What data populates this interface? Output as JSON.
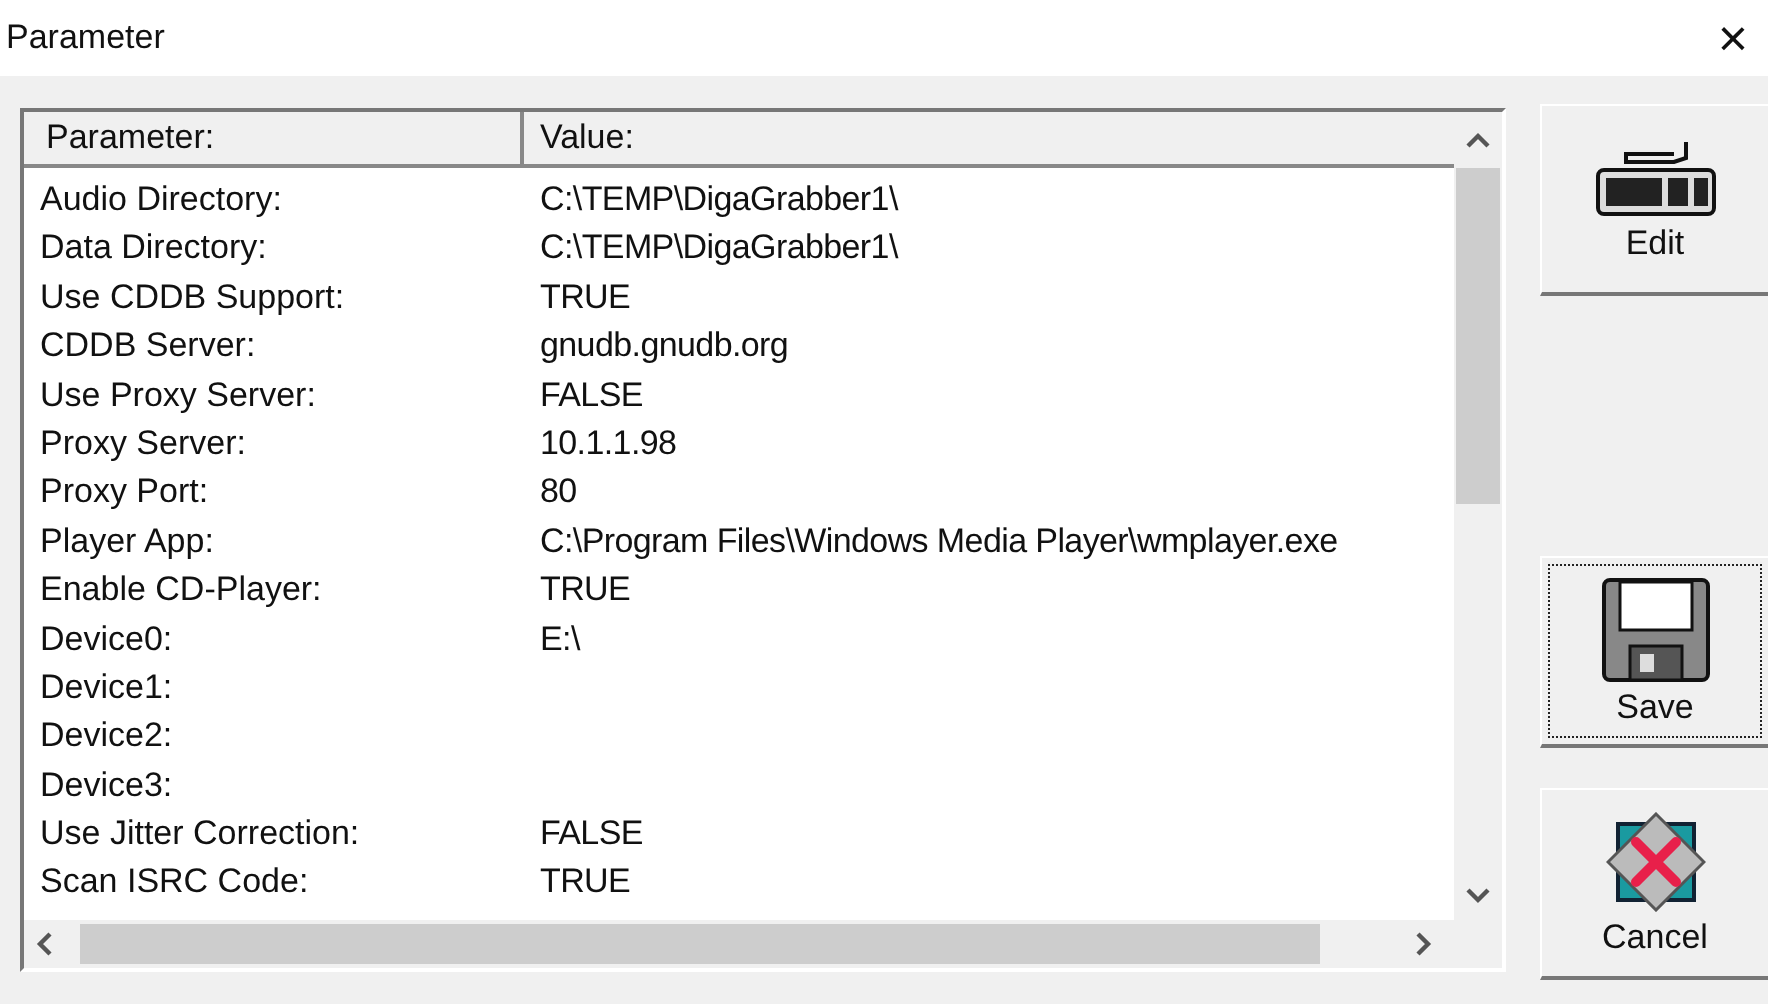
{
  "window": {
    "title": "Parameter",
    "close": "×"
  },
  "table": {
    "columns": [
      "Parameter:",
      "Value:"
    ],
    "rows": [
      {
        "name": "Audio Directory:",
        "value": "C:\\TEMP\\DigaGrabber1\\"
      },
      {
        "name": "Data Directory:",
        "value": "C:\\TEMP\\DigaGrabber1\\"
      },
      {
        "name": "Use CDDB Support:",
        "value": "TRUE"
      },
      {
        "name": "CDDB Server:",
        "value": "gnudb.gnudb.org"
      },
      {
        "name": "Use Proxy Server:",
        "value": "FALSE"
      },
      {
        "name": "Proxy Server:",
        "value": "10.1.1.98"
      },
      {
        "name": "Proxy Port:",
        "value": "80"
      },
      {
        "name": "Player App:",
        "value": "C:\\Program Files\\Windows Media Player\\wmplayer.exe"
      },
      {
        "name": "Enable CD-Player:",
        "value": "TRUE"
      },
      {
        "name": "Device0:",
        "value": "E:\\"
      },
      {
        "name": "Device1:"
      },
      {
        "name": "Device2:"
      },
      {
        "name": "Device3:"
      },
      {
        "name": "Use Jitter Correction:",
        "value": "FALSE"
      },
      {
        "name": "Scan ISRC Code:",
        "value": "TRUE"
      }
    ]
  },
  "buttons": [
    {
      "kind": "edit",
      "label": "Edit",
      "focused": false
    },
    {
      "kind": "save",
      "label": "Save",
      "focused": true
    },
    {
      "kind": "cancel",
      "label": "Cancel",
      "focused": false
    }
  ]
}
